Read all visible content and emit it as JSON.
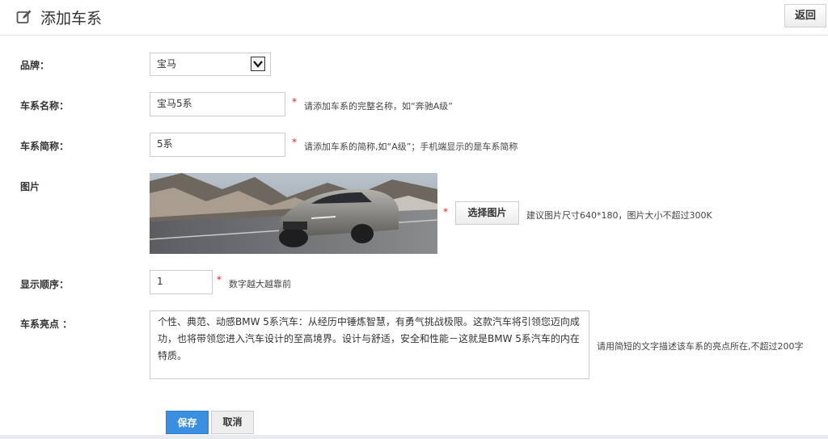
{
  "header": {
    "title": "添加车系",
    "back_label": "返回",
    "icon": "edit-icon"
  },
  "form": {
    "brand": {
      "label": "品牌：",
      "value": "宝马"
    },
    "series_name": {
      "label": "车系名称：",
      "value": "宝马5系",
      "hint": "请添加车系的完整名称，如“奔驰A级”"
    },
    "short_name": {
      "label": "车系简称：",
      "value": "5系",
      "hint": "请添加车系的简称,如“A级”；手机端显示的是车系简称"
    },
    "image": {
      "label": "图片",
      "choose_label": "选择图片",
      "hint": "建议图片尺寸640*180，图片大小不超过300K"
    },
    "order": {
      "label": "显示顺序：",
      "value": "1",
      "hint": "数字越大越靠前"
    },
    "highlights": {
      "label": "车系亮点 ：",
      "value": "个性、典范、动感BMW 5系汽车：从经历中锤炼智慧，有勇气挑战极限。这款汽车将引领您迈向成功，也将带领您进入汽车设计的至高境界。设计与舒适，安全和性能－这就是BMW 5系汽车的内在特质。",
      "hint": "请用简短的文字描述该车系的亮点所在,不超过200字"
    },
    "required_mark": "*"
  },
  "actions": {
    "save_label": "保存",
    "cancel_label": "取消"
  },
  "colors": {
    "accent": "#3b8fe0",
    "required": "#e02020"
  }
}
